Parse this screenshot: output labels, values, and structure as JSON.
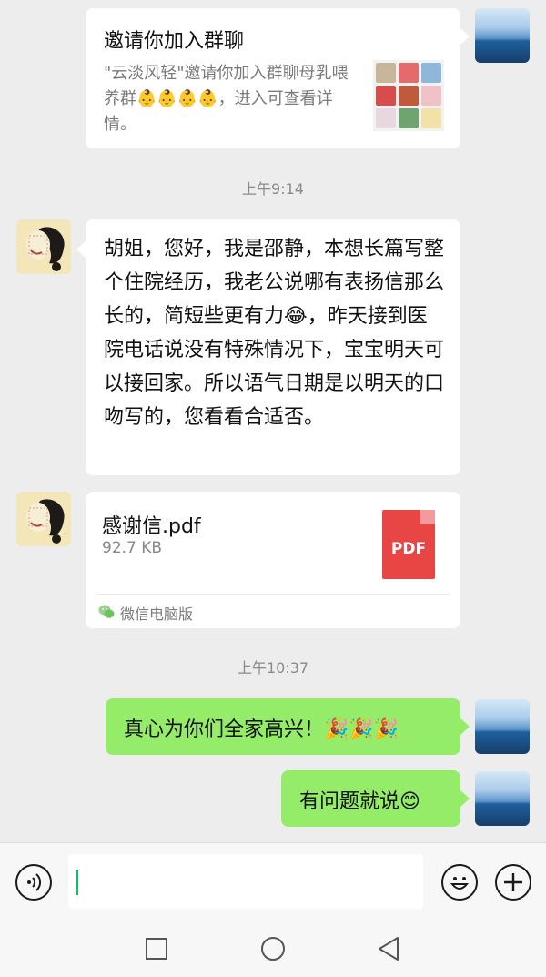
{
  "invite_card": {
    "title": "邀请你加入群聊",
    "description": "\"云淡风轻\"邀请你加入群聊母乳喂养群👶👶👶👶，进入可查看详情。"
  },
  "time_1": "上午9:14",
  "message_1": "胡姐，您好，我是邵静，本想长篇写整个住院经历，我老公说哪有表扬信那么长的，简短些更有力😂，昨天接到医院电话说没有特殊情况下，宝宝明天可以接回家。所以语气日期是以明天的口吻写的，您看看合适否。",
  "file_card": {
    "name": "感谢信.pdf",
    "size": "92.7 KB",
    "icon_label": "PDF",
    "source": "微信电脑版"
  },
  "time_2": "上午10:37",
  "reply_1": "真心为你们全家高兴！🎉🎉🎉",
  "reply_2": "有问题就说😊",
  "colors": {
    "chat_bg": "#ededed",
    "sent_bubble": "#95ec69",
    "received_bubble": "#ffffff",
    "pdf_red": "#e84545",
    "wechat_green": "#07c160"
  },
  "icons": {
    "voice": "voice-icon",
    "emoji": "emoji-icon",
    "plus": "plus-icon",
    "nav_recent": "square-icon",
    "nav_home": "circle-icon",
    "nav_back": "triangle-back-icon"
  }
}
